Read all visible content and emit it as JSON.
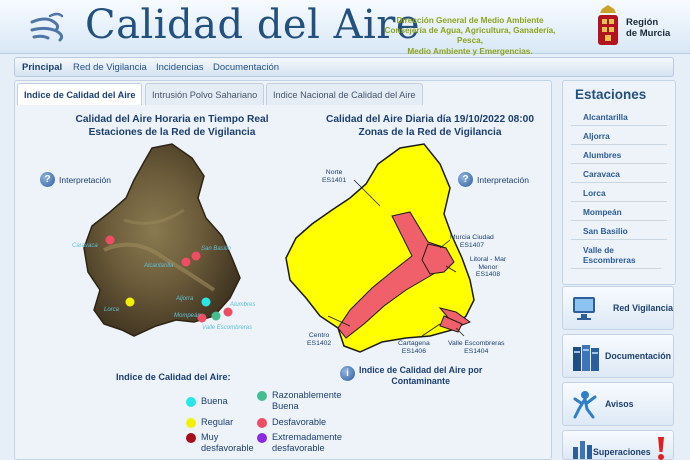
{
  "header": {
    "logo_text": "Calidad del Aire",
    "agency_lines": [
      "Dirección General de Medio Ambiente",
      "Consejería de Agua, Agricultura, Ganadería, Pesca,",
      "Medio Ambiente y Emergencias."
    ],
    "region_lines": [
      "Región",
      "de Murcia"
    ]
  },
  "nav": [
    "Principal",
    "Red de Vigilancia",
    "Incidencias",
    "Documentación"
  ],
  "tabs": [
    "Indice de Calidad del Aire",
    "Intrusión Polvo Sahariano",
    "Indice Nacional de Calidad del Aire"
  ],
  "left_panel": {
    "title_lines": [
      "Calidad del Aire Horaria en Tiempo Real",
      "Estaciones de la Red de Vigilancia"
    ],
    "help_label": "Interpretación",
    "map_labels": [
      "Caravaca",
      "San Basilio",
      "Alcantarilla",
      "Alumbres",
      "Lorca",
      "Aljorra",
      "Mompeán",
      "Valle Escombreras"
    ]
  },
  "right_panel": {
    "title_lines": [
      "Calidad del Aire Diaria día 19/10/2022 08:00",
      "Zonas de la Red de Vigilancia"
    ],
    "help_label": "Interpretación",
    "zones": [
      {
        "name": "Norte",
        "code": "ES1401"
      },
      {
        "name": "Murcia Ciudad",
        "code": "ES1407"
      },
      {
        "name": "Litoral - Mar Menor",
        "code": "ES1408"
      },
      {
        "name": "Centro",
        "code": "ES1402"
      },
      {
        "name": "Cartagena",
        "code": "ES1406"
      },
      {
        "name": "Valle Escombreras",
        "code": "ES1404"
      }
    ],
    "contaminante_lines": [
      "Indice de Calidad del Aire por",
      "Contaminante"
    ]
  },
  "legend": {
    "title": "Indice de Calidad del Aire:",
    "items": [
      {
        "label": "Buena",
        "color": "#29e6e6"
      },
      {
        "label": "Razonablemente Buena",
        "color": "#44bd8f"
      },
      {
        "label": "Regular",
        "color": "#f2f200"
      },
      {
        "label": "Desfavorable",
        "color": "#ee4d63"
      },
      {
        "label": "Muy desfavorable",
        "color": "#a50f1c"
      },
      {
        "label": "Extremadamente desfavorable",
        "color": "#8a2be2"
      }
    ]
  },
  "zone_colors": {
    "good_zone": "#ffff00",
    "unfavorable_zone": "#f0606b"
  },
  "sidebar": {
    "title": "Estaciones",
    "items": [
      "Alcantarilla",
      "Aljorra",
      "Alumbres",
      "Caravaca",
      "Lorca",
      "Mompeán",
      "San Basilio",
      "Valle de Escombreras"
    ]
  },
  "buttons": [
    {
      "label": "Red Vigilancia",
      "icon": "monitor-icon"
    },
    {
      "label": "Documentación",
      "icon": "books-icon"
    },
    {
      "label": "Avisos",
      "icon": "person-icon"
    },
    {
      "label": "Superaciones",
      "icon": "exclamation-icon"
    }
  ]
}
